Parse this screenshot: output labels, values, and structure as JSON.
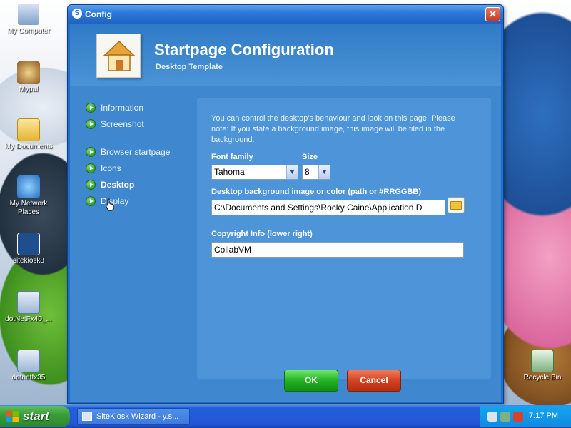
{
  "window": {
    "title": "Config",
    "title_icon": "S",
    "close_label": "✕"
  },
  "header": {
    "title": "Startpage Configuration",
    "subtitle": "Desktop Template"
  },
  "nav": {
    "items": [
      {
        "label": "Information",
        "icon": "arrow-icon"
      },
      {
        "label": "Screenshot",
        "icon": "arrow-icon"
      },
      {
        "label": "Browser startpage",
        "icon": "arrow-icon"
      },
      {
        "label": "Icons",
        "icon": "arrow-icon"
      },
      {
        "label": "Desktop",
        "icon": "arrow-icon",
        "active": true
      },
      {
        "label": "Display",
        "icon": "arrow-icon"
      }
    ]
  },
  "panel": {
    "intro": "You can control the desktop's behaviour and look on this page. Please note: If you state a background image, this image will be tiled in the background.",
    "font_family_label": "Font family",
    "font_family_value": "Tahoma",
    "size_label": "Size",
    "size_value": "8",
    "background_label": "Desktop background image or color (path or #RRGGBB)",
    "background_value": "C:\\Documents and Settings\\Rocky Caine\\Application D",
    "copyright_label": "Copyright Info (lower right)",
    "copyright_value": "CollabVM"
  },
  "buttons": {
    "ok": "OK",
    "cancel": "Cancel"
  },
  "desktop_icons": [
    {
      "label": "My Computer",
      "icon": "computer-icon"
    },
    {
      "label": "Mypal",
      "icon": "mypal-icon"
    },
    {
      "label": "My Documents",
      "icon": "documents-icon"
    },
    {
      "label": "My Network Places",
      "icon": "network-icon"
    },
    {
      "label": "sitekiosk8",
      "icon": "sitekiosk-icon"
    },
    {
      "label": "dotNetFx40_...",
      "icon": "installer-icon"
    },
    {
      "label": "dotnetfx35",
      "icon": "installer-icon"
    },
    {
      "label": "Recycle Bin",
      "icon": "recycle-bin-icon"
    }
  ],
  "taskbar": {
    "start_label": "start",
    "task_label": "SiteKiosk Wizard - y.s...",
    "clock": "7:17 PM"
  },
  "colors": {
    "accent": "#1d6fcf",
    "panel": "#4d95d8",
    "ok": "#1fae20",
    "cancel": "#d1401d"
  }
}
